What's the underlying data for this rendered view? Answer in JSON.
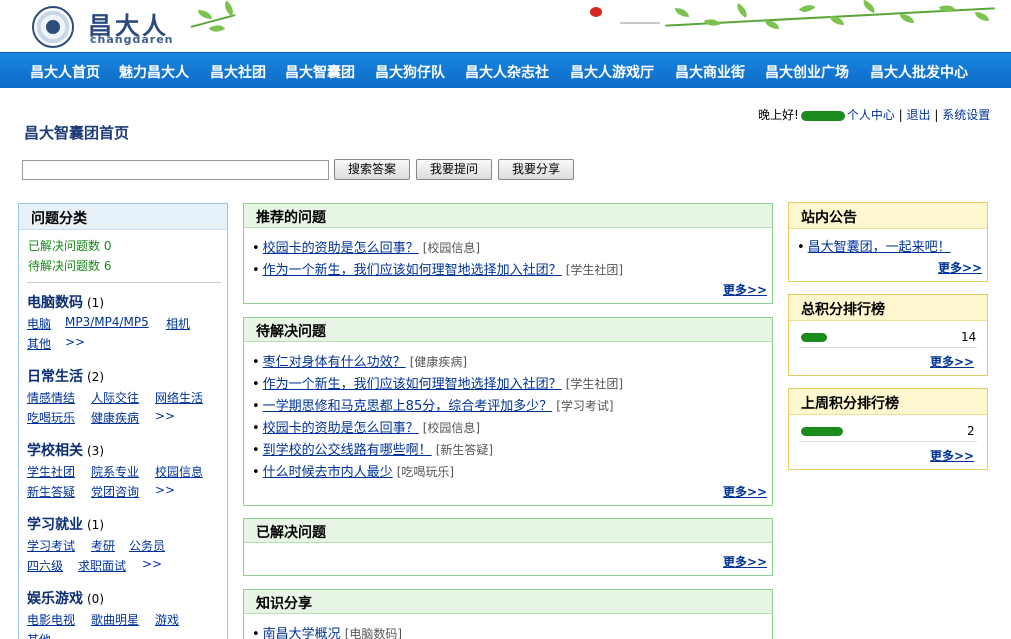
{
  "header": {
    "logo_cn": "昌大人",
    "logo_en": "changdaren"
  },
  "nav": {
    "items": [
      "昌大人首页",
      "魅力昌大人",
      "昌大社团",
      "昌大智囊团",
      "昌大狗仔队",
      "昌大人杂志社",
      "昌大人游戏厅",
      "昌大商业街",
      "昌大创业广场",
      "昌大人批发中心"
    ]
  },
  "user_bar": {
    "greeting": "晚上好!",
    "profile": "个人中心",
    "sep1": " | ",
    "logout": "退出",
    "sep2": " | ",
    "settings": "系统设置"
  },
  "page_title": "昌大智囊团首页",
  "search": {
    "value": "",
    "buttons": [
      "搜索答案",
      "我要提问",
      "我要分享"
    ]
  },
  "sidebar": {
    "title": "问题分类",
    "solved_label": "已解决问题数",
    "solved_count": "0",
    "pending_label": "待解决问题数",
    "pending_count": "6",
    "more_symbol": ">>",
    "categories": [
      {
        "name": "电脑数码",
        "count": "(1)",
        "subs": [
          "电脑",
          "MP3/MP4/MP5",
          "相机",
          "其他"
        ]
      },
      {
        "name": "日常生活",
        "count": "(2)",
        "subs": [
          "情感情结",
          "人际交往",
          "网络生活",
          "吃喝玩乐",
          "健康疾病"
        ]
      },
      {
        "name": "学校相关",
        "count": "(3)",
        "subs": [
          "学生社团",
          "院系专业",
          "校园信息",
          "新生答疑",
          "党团咨询"
        ]
      },
      {
        "name": "学习就业",
        "count": "(1)",
        "subs": [
          "学习考试",
          "考研",
          "公务员",
          "四六级",
          "求职面试"
        ]
      },
      {
        "name": "娱乐游戏",
        "count": "(0)",
        "subs": [
          "电影电视",
          "歌曲明星",
          "游戏",
          "其他"
        ]
      }
    ]
  },
  "panels": {
    "more_label": "更多>>",
    "bullet": "•",
    "recommended": {
      "title": "推荐的问题",
      "items": [
        {
          "q": "校园卡的资助是怎么回事？",
          "tag": "[校园信息]"
        },
        {
          "q": "作为一个新生，我们应该如何理智地选择加入社团？",
          "tag": "[学生社团]"
        }
      ]
    },
    "pending": {
      "title": "待解决问题",
      "items": [
        {
          "q": "枣仁对身体有什么功效？",
          "tag": "[健康疾病]"
        },
        {
          "q": "作为一个新生，我们应该如何理智地选择加入社团？",
          "tag": "[学生社团]"
        },
        {
          "q": "一学期思修和马克思都上85分，综合考评加多少？",
          "tag": "[学习考试]"
        },
        {
          "q": "校园卡的资助是怎么回事？",
          "tag": "[校园信息]"
        },
        {
          "q": "到学校的公交线路有哪些啊！",
          "tag": "[新生答疑]"
        },
        {
          "q": "什么时候去市内人最少",
          "tag": "[吃喝玩乐]"
        }
      ]
    },
    "solved": {
      "title": "已解决问题"
    },
    "knowledge": {
      "title": "知识分享",
      "items": [
        {
          "q": "南昌大学概况",
          "tag": "[电脑数码]"
        }
      ]
    }
  },
  "right": {
    "notice": {
      "title": "站内公告",
      "item": "昌大智囊团，一起来吧！"
    },
    "total_rank": {
      "title": "总积分排行榜",
      "score": "14"
    },
    "week_rank": {
      "title": "上周积分排行榜",
      "score": "2"
    }
  },
  "colors": {
    "nav_bg": "#1178d6",
    "link": "#003399",
    "sidebar_border": "#9ec4e6",
    "panel_border": "#8fcf8f",
    "right_border": "#e5cc60",
    "stat_green": "#1a8a1a"
  }
}
